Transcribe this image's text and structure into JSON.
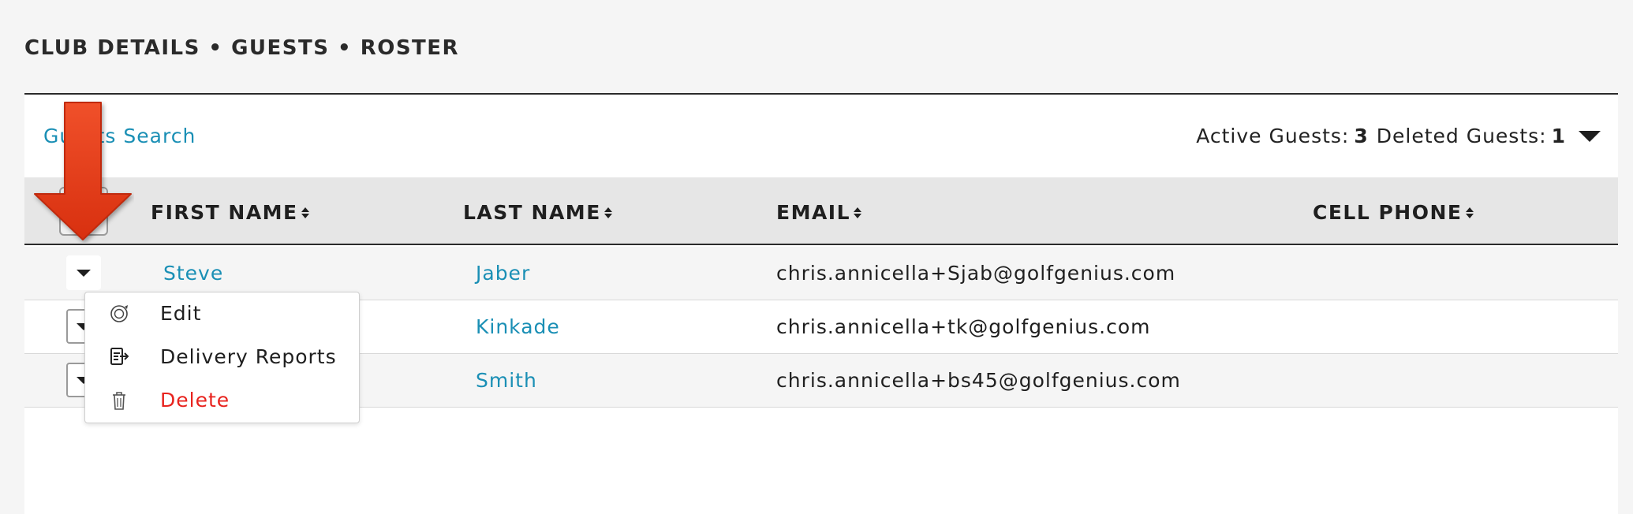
{
  "breadcrumb": "CLUB DETAILS • GUESTS • ROSTER",
  "toolbar": {
    "search_link": "Guests Search",
    "active_label": "Active Guests:",
    "active_count": "3",
    "deleted_label": "Deleted Guests:",
    "deleted_count": "1"
  },
  "table": {
    "headers": {
      "first_name": "FIRST NAME",
      "last_name": "LAST NAME",
      "email": "EMAIL",
      "cell_phone": "CELL PHONE"
    },
    "rows": [
      {
        "first_name": "Steve",
        "last_name": "Jaber",
        "email": "chris.annicella+Sjab@golfgenius.com",
        "cell_phone": ""
      },
      {
        "first_name": "",
        "last_name": "Kinkade",
        "email": "chris.annicella+tk@golfgenius.com",
        "cell_phone": ""
      },
      {
        "first_name": "",
        "last_name": "Smith",
        "email": "chris.annicella+bs45@golfgenius.com",
        "cell_phone": ""
      }
    ]
  },
  "row_menu": {
    "items": [
      {
        "label": "Edit",
        "icon": "edit-icon"
      },
      {
        "label": "Delivery Reports",
        "icon": "delivery-reports-icon"
      },
      {
        "label": "Delete",
        "icon": "trash-icon"
      }
    ]
  },
  "colors": {
    "link": "#1a8fb5",
    "danger": "#e8231e",
    "header_bg": "#e6e6e6",
    "annotation_arrow": "#e8401c"
  }
}
